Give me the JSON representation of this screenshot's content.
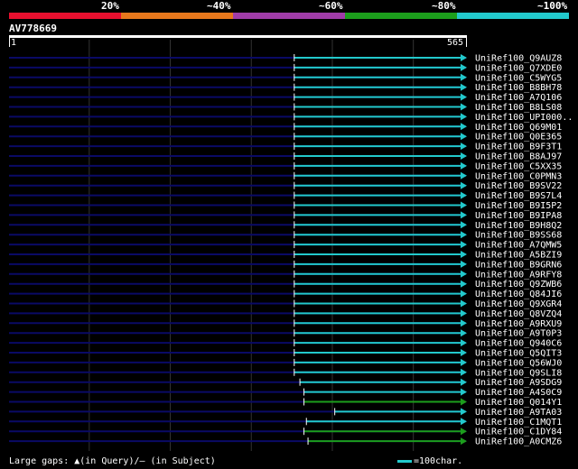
{
  "legend": {
    "labels": [
      "20%",
      "~40%",
      "~60%",
      "~80%",
      "~100%"
    ],
    "colors": [
      "#e8102f",
      "#e8781c",
      "#a03ca8",
      "#1c9e1c",
      "#22c9cc"
    ]
  },
  "query": {
    "name": "AV778669",
    "start_label": "1",
    "end_label": "565",
    "length": 565
  },
  "colors": {
    "background": "#000000",
    "track": "#0a0a66",
    "grid": "#333333",
    "hit_cyan": "#22c9cc",
    "hit_green": "#1c9e1c",
    "text": "#ffffff"
  },
  "hits": [
    {
      "name": "UniRef100_Q9AUZ8",
      "start": 353,
      "end": 565,
      "color": "cyan"
    },
    {
      "name": "UniRef100_Q7XDE0",
      "start": 353,
      "end": 565,
      "color": "cyan"
    },
    {
      "name": "UniRef100_C5WYG5",
      "start": 353,
      "end": 565,
      "color": "cyan"
    },
    {
      "name": "UniRef100_B8BH78",
      "start": 353,
      "end": 565,
      "color": "cyan"
    },
    {
      "name": "UniRef100_A7Q106",
      "start": 353,
      "end": 565,
      "color": "cyan"
    },
    {
      "name": "UniRef100_B8LS08",
      "start": 353,
      "end": 565,
      "color": "cyan"
    },
    {
      "name": "UniRef100_UPI000..",
      "start": 353,
      "end": 565,
      "color": "cyan"
    },
    {
      "name": "UniRef100_Q69M01",
      "start": 353,
      "end": 565,
      "color": "cyan"
    },
    {
      "name": "UniRef100_Q0E365",
      "start": 353,
      "end": 565,
      "color": "cyan"
    },
    {
      "name": "UniRef100_B9F3T1",
      "start": 353,
      "end": 565,
      "color": "cyan"
    },
    {
      "name": "UniRef100_B8AJ97",
      "start": 353,
      "end": 565,
      "color": "cyan"
    },
    {
      "name": "UniRef100_C5XX35",
      "start": 353,
      "end": 565,
      "color": "cyan"
    },
    {
      "name": "UniRef100_C0PMN3",
      "start": 353,
      "end": 565,
      "color": "cyan"
    },
    {
      "name": "UniRef100_B9SV22",
      "start": 353,
      "end": 565,
      "color": "cyan"
    },
    {
      "name": "UniRef100_B9S7L4",
      "start": 353,
      "end": 565,
      "color": "cyan"
    },
    {
      "name": "UniRef100_B9I5P2",
      "start": 353,
      "end": 565,
      "color": "cyan"
    },
    {
      "name": "UniRef100_B9IPA8",
      "start": 353,
      "end": 565,
      "color": "cyan"
    },
    {
      "name": "UniRef100_B9H8Q2",
      "start": 353,
      "end": 565,
      "color": "cyan"
    },
    {
      "name": "UniRef100_B9SS68",
      "start": 353,
      "end": 565,
      "color": "cyan"
    },
    {
      "name": "UniRef100_A7QMW5",
      "start": 353,
      "end": 565,
      "color": "cyan"
    },
    {
      "name": "UniRef100_A5BZI9",
      "start": 353,
      "end": 565,
      "color": "cyan"
    },
    {
      "name": "UniRef100_B9GRN6",
      "start": 353,
      "end": 565,
      "color": "cyan"
    },
    {
      "name": "UniRef100_A9RFY8",
      "start": 353,
      "end": 565,
      "color": "cyan"
    },
    {
      "name": "UniRef100_Q9ZWB6",
      "start": 353,
      "end": 565,
      "color": "cyan"
    },
    {
      "name": "UniRef100_Q84JI6",
      "start": 353,
      "end": 565,
      "color": "cyan"
    },
    {
      "name": "UniRef100_Q9XGR4",
      "start": 353,
      "end": 565,
      "color": "cyan"
    },
    {
      "name": "UniRef100_Q8VZQ4",
      "start": 353,
      "end": 565,
      "color": "cyan"
    },
    {
      "name": "UniRef100_A9RXU9",
      "start": 353,
      "end": 565,
      "color": "cyan"
    },
    {
      "name": "UniRef100_A9T0P3",
      "start": 353,
      "end": 565,
      "color": "cyan"
    },
    {
      "name": "UniRef100_Q940C6",
      "start": 353,
      "end": 565,
      "color": "cyan"
    },
    {
      "name": "UniRef100_Q5QIT3",
      "start": 353,
      "end": 565,
      "color": "cyan"
    },
    {
      "name": "UniRef100_Q56WJ0",
      "start": 353,
      "end": 565,
      "color": "cyan"
    },
    {
      "name": "UniRef100_Q9SLI8",
      "start": 353,
      "end": 565,
      "color": "cyan"
    },
    {
      "name": "UniRef100_A9SDG9",
      "start": 360,
      "end": 565,
      "color": "cyan"
    },
    {
      "name": "UniRef100_A4S0C9",
      "start": 365,
      "end": 565,
      "color": "cyan"
    },
    {
      "name": "UniRef100_Q014Y1",
      "start": 365,
      "end": 565,
      "color": "green"
    },
    {
      "name": "UniRef100_A9TA03",
      "start": 403,
      "end": 565,
      "color": "cyan"
    },
    {
      "name": "UniRef100_C1MQT1",
      "start": 368,
      "end": 565,
      "color": "cyan"
    },
    {
      "name": "UniRef100_C1DY84",
      "start": 365,
      "end": 565,
      "color": "green"
    },
    {
      "name": "UniRef100_A0CMZ6",
      "start": 370,
      "end": 565,
      "color": "green"
    }
  ],
  "footer": {
    "gaps_text": "Large gaps: ▲(in Query)/— (in Subject)",
    "scale_text": "=100char."
  }
}
